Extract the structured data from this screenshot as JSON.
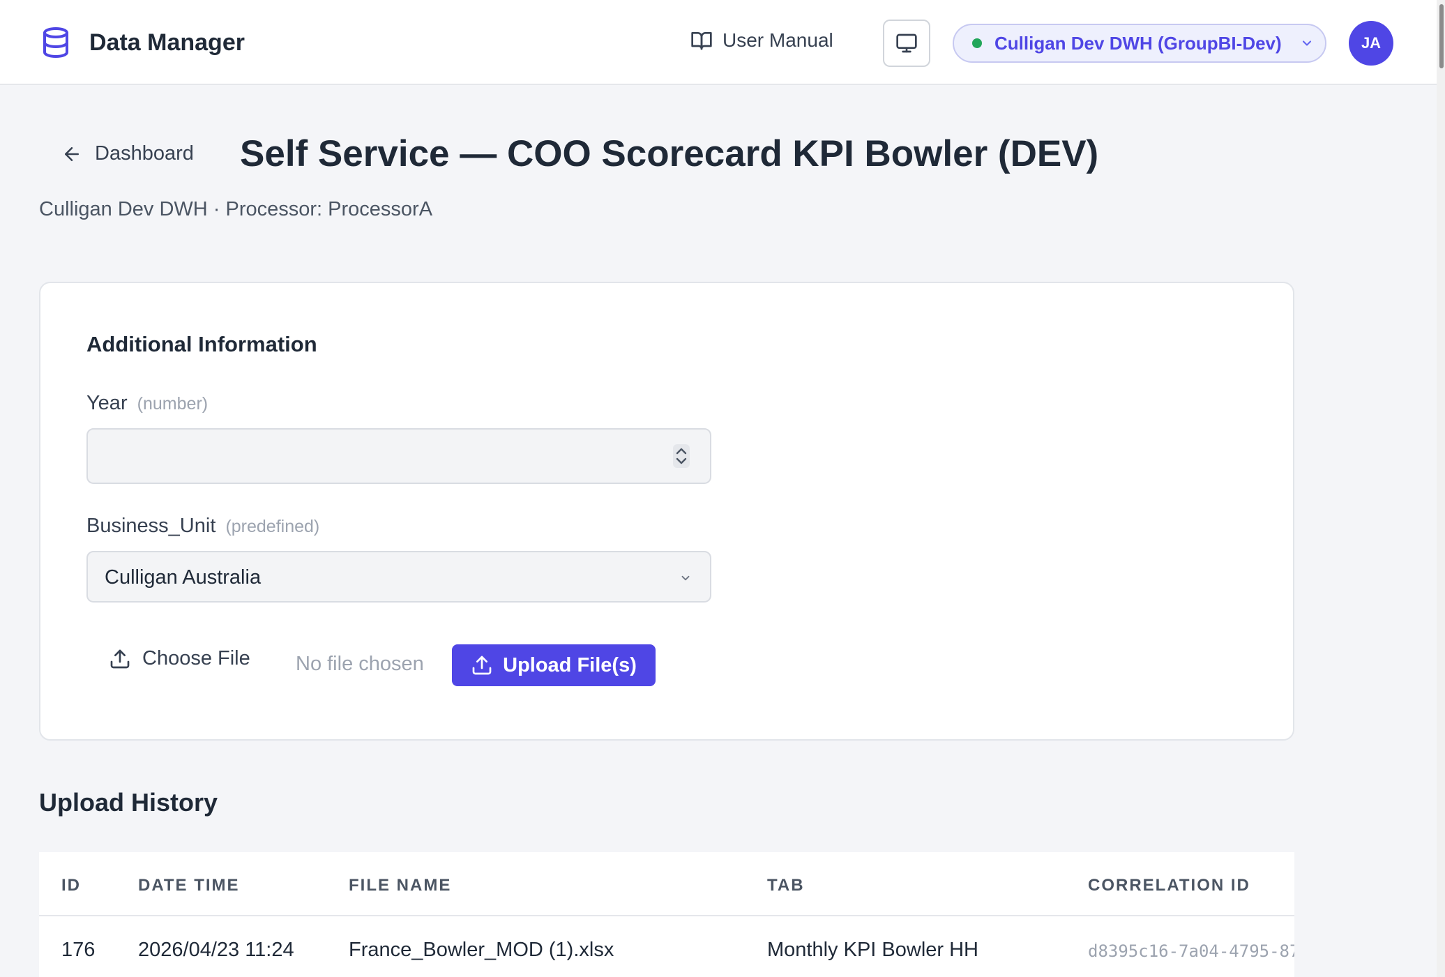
{
  "header": {
    "app_name": "Data Manager",
    "user_manual": "User Manual",
    "environment": "Culligan Dev DWH (GroupBI-Dev)",
    "env_status_color": "#22a65a",
    "avatar_initials": "JA",
    "icons": [
      "database-icon",
      "book-icon",
      "monitor-icon",
      "chevron-down-icon"
    ]
  },
  "page": {
    "back_label": "Dashboard",
    "title": "Self Service — COO Scorecard KPI Bowler (DEV)",
    "subtitle": "Culligan Dev DWH · Processor: ProcessorA"
  },
  "form": {
    "section_title": "Additional Information",
    "year_label": "Year",
    "year_hint": "(number)",
    "year_value": "",
    "business_unit_label": "Business_Unit",
    "business_unit_hint": "(predefined)",
    "business_unit_value": "Culligan Australia",
    "choose_file_label": "Choose File",
    "no_file_text": "No file chosen",
    "upload_button": "Upload File(s)",
    "accent_color": "#4f46e5"
  },
  "history": {
    "title": "Upload History",
    "columns": [
      "ID",
      "DATE TIME",
      "FILE NAME",
      "TAB",
      "CORRELATION ID"
    ],
    "rows": [
      {
        "id": "176",
        "datetime": "2026/04/23 11:24",
        "file_name": "France_Bowler_MOD (1).xlsx",
        "tab": "Monthly KPI Bowler HH",
        "correlation_id": "d8395c16-7a04-4795-87"
      }
    ]
  }
}
